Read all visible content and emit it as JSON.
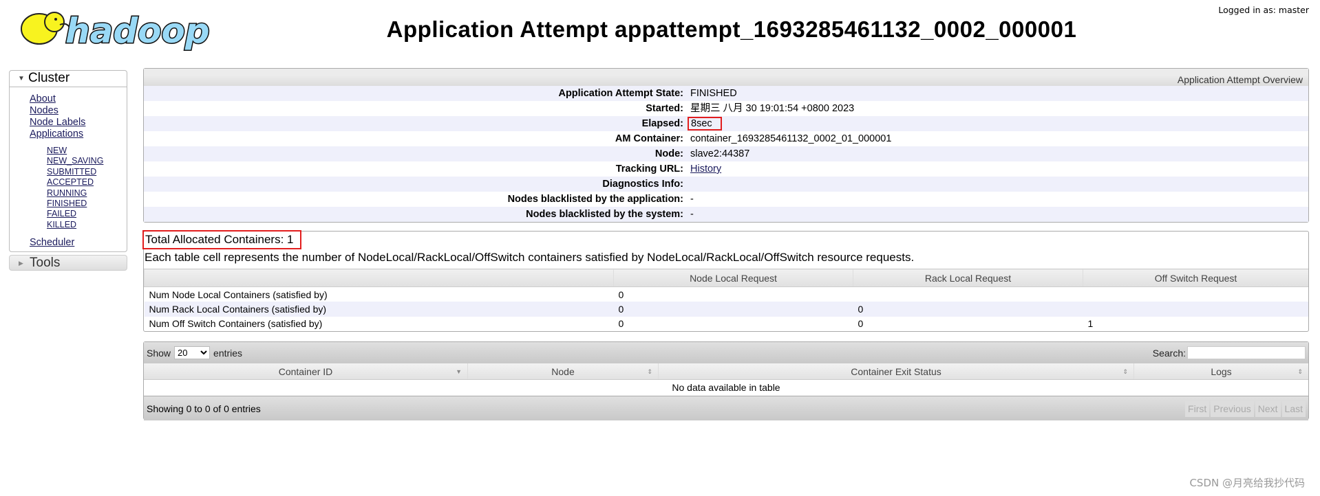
{
  "header": {
    "logo_text": "hadoop",
    "title": "Application Attempt appattempt_1693285461132_0002_000001",
    "logged_in": "Logged in as: master"
  },
  "sidebar": {
    "cluster_label": "Cluster",
    "links": [
      "About",
      "Nodes",
      "Node Labels",
      "Applications"
    ],
    "app_states": [
      "NEW",
      "NEW_SAVING",
      "SUBMITTED",
      "ACCEPTED",
      "RUNNING",
      "FINISHED",
      "FAILED",
      "KILLED"
    ],
    "scheduler": "Scheduler",
    "tools_label": "Tools"
  },
  "overview": {
    "heading": "Application Attempt Overview",
    "rows": [
      {
        "k": "Application Attempt State:",
        "v": "FINISHED"
      },
      {
        "k": "Started:",
        "v": "星期三 八月 30 19:01:54 +0800 2023"
      },
      {
        "k": "Elapsed:",
        "v": "8sec"
      },
      {
        "k": "AM Container:",
        "v": "container_1693285461132_0002_01_000001"
      },
      {
        "k": "Node:",
        "v": "slave2:44387"
      },
      {
        "k": "Tracking URL:",
        "v": "History"
      },
      {
        "k": "Diagnostics Info:",
        "v": ""
      },
      {
        "k": "Nodes blacklisted by the application:",
        "v": "-"
      },
      {
        "k": "Nodes blacklisted by the system:",
        "v": "-"
      }
    ]
  },
  "allocation": {
    "title": "Total Allocated Containers: 1",
    "description": "Each table cell represents the number of NodeLocal/RackLocal/OffSwitch containers satisfied by NodeLocal/RackLocal/OffSwitch resource requests.",
    "columns": [
      "",
      "Node Local Request",
      "Rack Local Request",
      "Off Switch Request"
    ],
    "rows": [
      [
        "Num Node Local Containers (satisfied by)",
        "0",
        "",
        ""
      ],
      [
        "Num Rack Local Containers (satisfied by)",
        "0",
        "0",
        ""
      ],
      [
        "Num Off Switch Containers (satisfied by)",
        "0",
        "0",
        "1"
      ]
    ]
  },
  "containers": {
    "show": "Show",
    "page_size": "20",
    "entries": "entries",
    "search_label": "Search:",
    "search_value": "",
    "columns": [
      "Container ID",
      "Node",
      "Container Exit Status",
      "Logs"
    ],
    "empty": "No data available in table",
    "info": "Showing 0 to 0 of 0 entries",
    "pager": [
      "First",
      "Previous",
      "Next",
      "Last"
    ]
  },
  "watermark": "CSDN @月亮给我抄代码"
}
